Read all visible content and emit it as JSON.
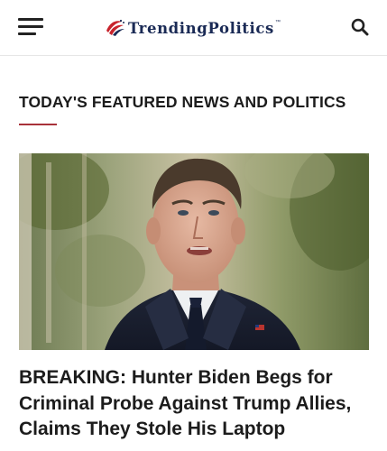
{
  "header": {
    "menu_icon": "hamburger-menu-icon",
    "logo": {
      "text": "TrendingPolitics",
      "trademark": "™",
      "icon": "flag-swoosh-icon",
      "colors": {
        "red": "#c8232c",
        "navy": "#1a2a55"
      }
    },
    "search_icon": "search-icon"
  },
  "section": {
    "title": "TODAY'S FEATURED NEWS AND POLITICS",
    "accent_color": "#a8323a"
  },
  "featured_article": {
    "image_alt": "Hunter Biden speaking, wearing a navy suit with an American flag pin",
    "headline": "BREAKING: Hunter Biden Begs for Criminal Probe Against Trump Allies, Claims They Stole His Laptop"
  }
}
